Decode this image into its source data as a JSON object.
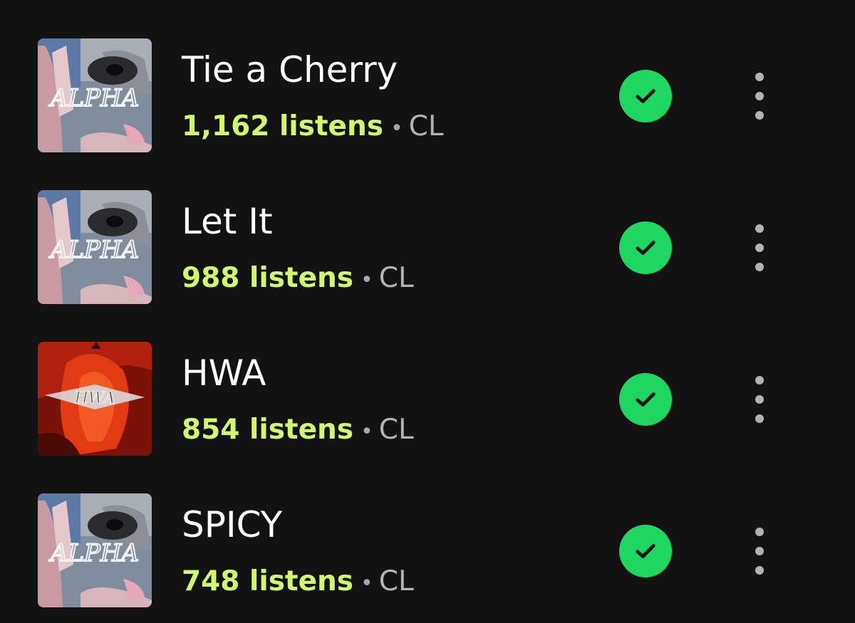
{
  "colors": {
    "background": "#121212",
    "title": "#ffffff",
    "listens": "#d2f66c",
    "secondary": "#b3b3b3",
    "check": "#1ed760"
  },
  "tracks": [
    {
      "title": "Tie a Cherry",
      "listens": "1,162 listens",
      "separator": "•",
      "artist": "CL",
      "cover": "alpha-album-cover",
      "cover_text": "ALPHA",
      "saved_icon": "check-circle-icon",
      "more_icon": "more-vertical-icon"
    },
    {
      "title": "Let It",
      "listens": "988 listens",
      "separator": "•",
      "artist": "CL",
      "cover": "alpha-album-cover",
      "cover_text": "ALPHA",
      "saved_icon": "check-circle-icon",
      "more_icon": "more-vertical-icon"
    },
    {
      "title": "HWA",
      "listens": "854 listens",
      "separator": "•",
      "artist": "CL",
      "cover": "hwa-single-cover",
      "cover_text": "HWA",
      "saved_icon": "check-circle-icon",
      "more_icon": "more-vertical-icon"
    },
    {
      "title": "SPICY",
      "listens": "748 listens",
      "separator": "•",
      "artist": "CL",
      "cover": "alpha-album-cover",
      "cover_text": "ALPHA",
      "saved_icon": "check-circle-icon",
      "more_icon": "more-vertical-icon"
    }
  ]
}
